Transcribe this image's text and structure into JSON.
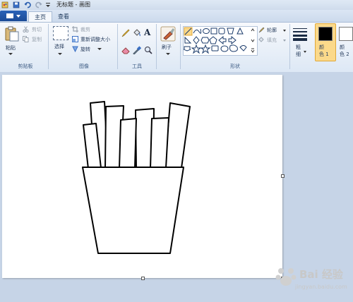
{
  "window": {
    "title": "无标题 - 画图"
  },
  "tabs": [
    {
      "label": "主页"
    },
    {
      "label": "查看"
    }
  ],
  "clipboard": {
    "paste": "粘贴",
    "cut": "剪切",
    "copy": "复制",
    "group": "剪贴板"
  },
  "image": {
    "select": "选择",
    "crop": "裁剪",
    "resize": "重新调整大小",
    "rotate": "旋转",
    "group": "图像"
  },
  "tools": {
    "group": "工具"
  },
  "brushes": {
    "label": "刷子"
  },
  "shapes": {
    "outline": "轮廓",
    "fill": "填充",
    "group": "形状"
  },
  "size": {
    "label": "粗\n细"
  },
  "colors": {
    "color1": "颜\n色 1",
    "color2": "颜\n色 2",
    "color1_value": "#000000",
    "color2_value": "#ffffff"
  },
  "accent": {
    "ribbon": "#dde8f5",
    "active_color_bg": "#fbd98a"
  },
  "watermark": {
    "text": "Bai 经验",
    "url": "jingyan.baidu.com"
  }
}
